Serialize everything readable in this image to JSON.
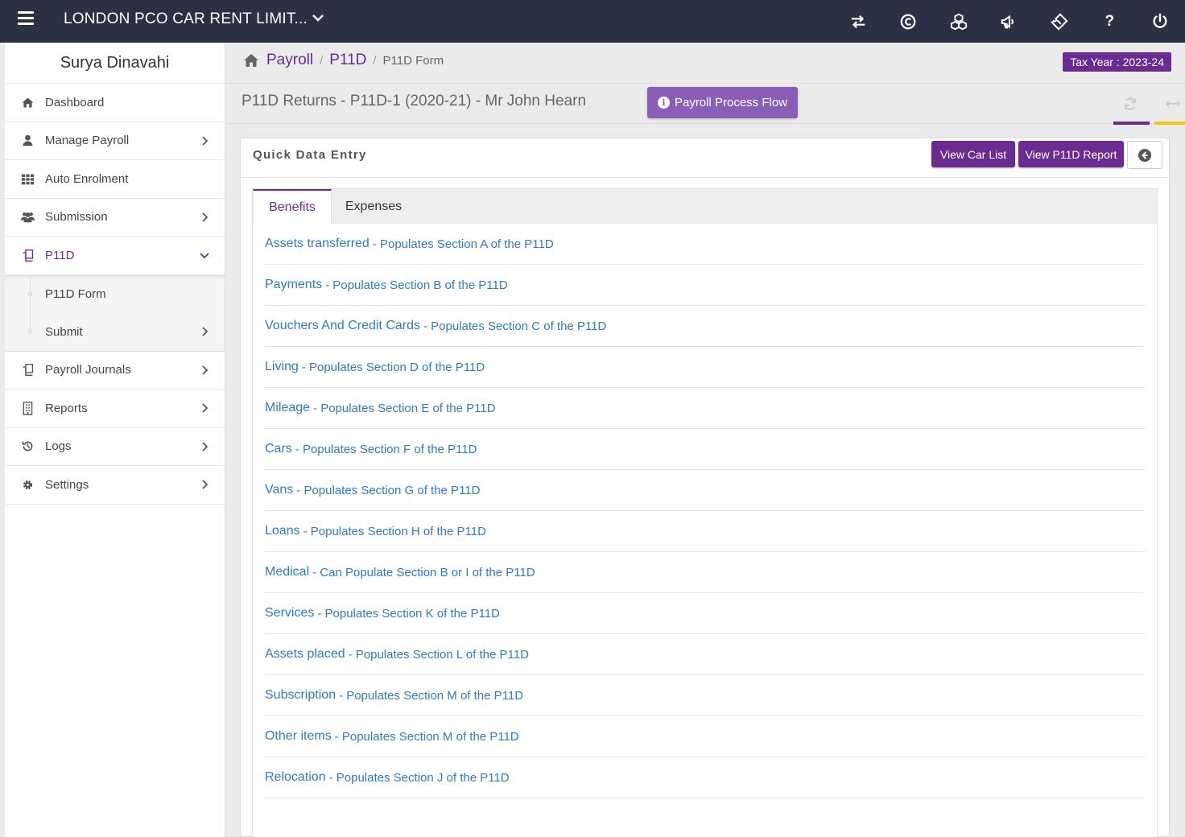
{
  "topbar": {
    "company": "LONDON PCO CAR RENT LIMIT...",
    "icons": [
      "transfer-icon",
      "copyright-icon",
      "cubes-icon",
      "bullhorn-icon",
      "ticket-icon",
      "help-icon",
      "power-icon"
    ],
    "help_label": "?"
  },
  "sidebar": {
    "user_name": "Surya Dinavahi",
    "items": [
      {
        "label": "Dashboard",
        "icon": "home-icon"
      },
      {
        "label": "Manage Payroll",
        "icon": "user-icon"
      },
      {
        "label": "Auto Enrolment",
        "icon": "grid-icon"
      },
      {
        "label": "Submission",
        "icon": "users-icon"
      },
      {
        "label": "P11D",
        "icon": "copy-icon"
      },
      {
        "label": "Payroll Journals",
        "icon": "copy-icon"
      },
      {
        "label": "Reports",
        "icon": "building-icon"
      },
      {
        "label": "Logs",
        "icon": "history-icon"
      },
      {
        "label": "Settings",
        "icon": "gear-icon"
      }
    ],
    "submenu": [
      {
        "label": "P11D Form"
      },
      {
        "label": "Submit"
      }
    ]
  },
  "breadcrumb": {
    "items": [
      "Payroll",
      "P11D"
    ],
    "separator": "/",
    "current": "P11D Form"
  },
  "tax_year": "Tax Year : 2023-24",
  "page": {
    "title": "P11D Returns - P11D-1 (2020-21) - Mr John Hearn",
    "process_button": "Payroll Process Flow",
    "info_glyph": "i"
  },
  "panel": {
    "title": "Quick Data Entry",
    "view_car_list": "View Car List",
    "view_report": "View P11D Report",
    "tabs": [
      "Benefits",
      "Expenses"
    ],
    "benefits": [
      {
        "title": "Assets transferred",
        "desc": "- Populates Section A of the P11D"
      },
      {
        "title": "Payments",
        "desc": "- Populates Section B of the P11D"
      },
      {
        "title": "Vouchers And Credit Cards",
        "desc": "- Populates Section C of the P11D"
      },
      {
        "title": "Living",
        "desc": "- Populates Section D of the P11D"
      },
      {
        "title": "Mileage",
        "desc": "- Populates Section E of the P11D"
      },
      {
        "title": "Cars",
        "desc": "- Populates Section F of the P11D"
      },
      {
        "title": "Vans",
        "desc": "- Populates Section G of the P11D"
      },
      {
        "title": "Loans",
        "desc": "- Populates Section H of the P11D"
      },
      {
        "title": "Medical",
        "desc": "- Can Populate Section B or I of the P11D"
      },
      {
        "title": "Services",
        "desc": "- Populates Section K of the P11D"
      },
      {
        "title": "Assets placed",
        "desc": "- Populates Section L of the P11D"
      },
      {
        "title": "Subscription",
        "desc": "- Populates Section M of the P11D"
      },
      {
        "title": "Other items",
        "desc": "- Populates Section M of the P11D"
      },
      {
        "title": "Relocation",
        "desc": "- Populates Section J of the P11D"
      }
    ]
  },
  "colors": {
    "topbar": "#2a3142",
    "accent": "#6a2c91",
    "process_button": "#8a5db7",
    "link": "#2f7bbf",
    "highlight_yellow": "#f5c518"
  }
}
